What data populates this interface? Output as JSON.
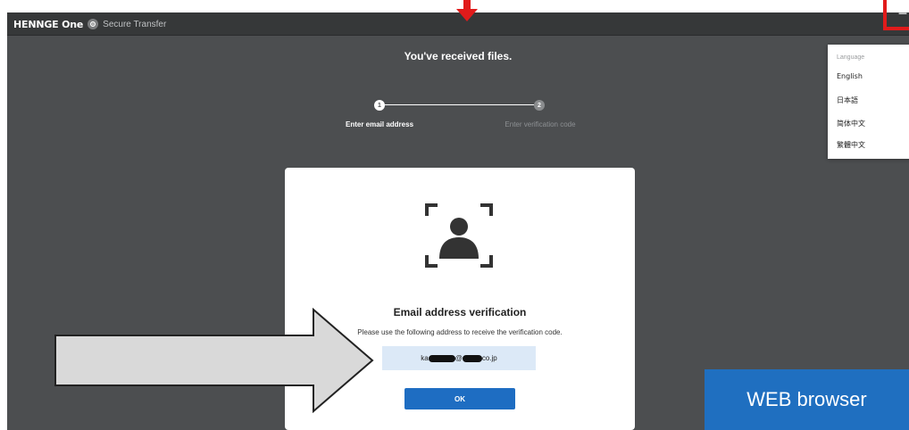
{
  "app": {
    "brand_name": "HENNGE One",
    "product": "Secure Transfer"
  },
  "page": {
    "title": "You've received files."
  },
  "steps": [
    {
      "number": "1",
      "label": "Enter email address",
      "active": true
    },
    {
      "number": "2",
      "label": "Enter verification code",
      "active": false
    }
  ],
  "menu": {
    "icon": "hamburger-icon",
    "glyph": "≡"
  },
  "language_menu": {
    "header": "Language",
    "items": [
      "English",
      "日本語",
      "简体中文",
      "繁體中文"
    ],
    "selected": "English",
    "check_glyph": "✓"
  },
  "card": {
    "icon": "face-verification-icon",
    "title": "Email address verification",
    "description": "Please use the following address to receive the verification code.",
    "email_prefix": "ka",
    "email_mid": "@",
    "email_suffix": "co.jp",
    "ok_label": "OK"
  },
  "annotation": {
    "label": "WEB browser"
  },
  "colors": {
    "background": "#4c4e50",
    "topbar": "#363839",
    "accent_red": "#e11b1b",
    "button_blue": "#1e6dc2",
    "badge_blue": "#1f6fc0",
    "email_box": "#dce9f7"
  }
}
